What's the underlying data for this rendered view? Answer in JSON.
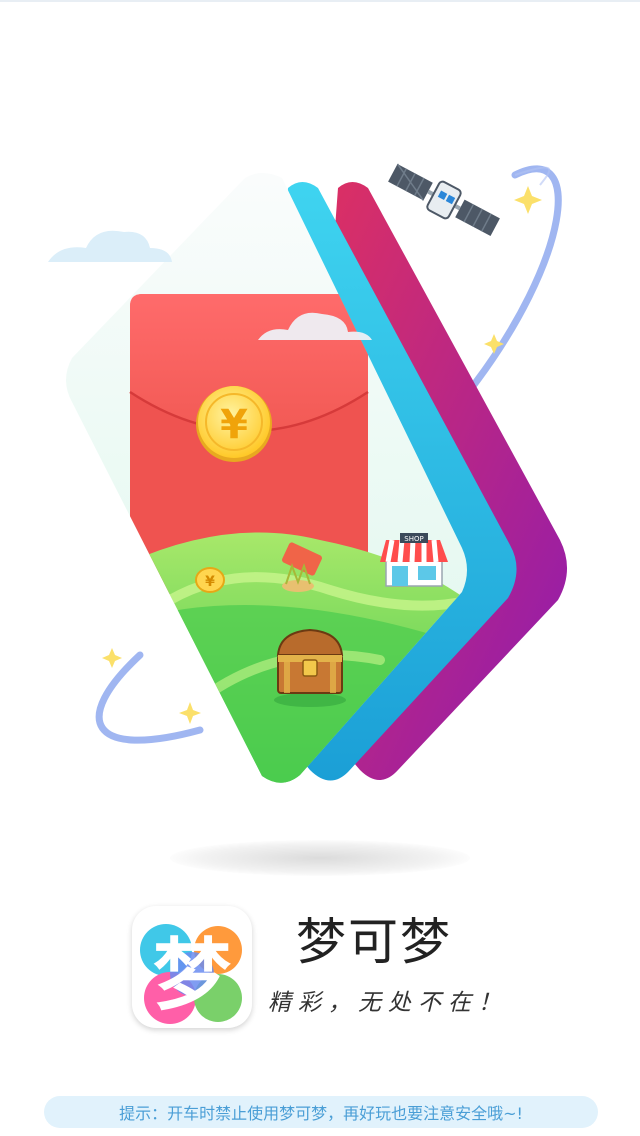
{
  "app": {
    "name": "梦可梦",
    "slogan": "精彩，无处不在！",
    "icon_char": "梦"
  },
  "illustration": {
    "red_envelope_symbol": "¥",
    "shop_sign": "SHOP",
    "icons": [
      "satellite-icon",
      "cloud-icon",
      "sparkle-icon",
      "coin-icon",
      "shop-icon",
      "treasure-chest-icon",
      "ticket-icon"
    ]
  },
  "tip": {
    "text": "提示：开车时禁止使用梦可梦，再好玩也要注意安全哦~!"
  },
  "colors": {
    "envelope_red": "#ef5350",
    "coin_gold": "#ffd54f",
    "hill_green": "#7ed957",
    "card_cyan": "#29c3e8",
    "card_magenta": "#c2185b",
    "orbit_blue": "#8fa9ef",
    "tip_bg": "#e1f2fc",
    "tip_text": "#4a9ed6"
  }
}
